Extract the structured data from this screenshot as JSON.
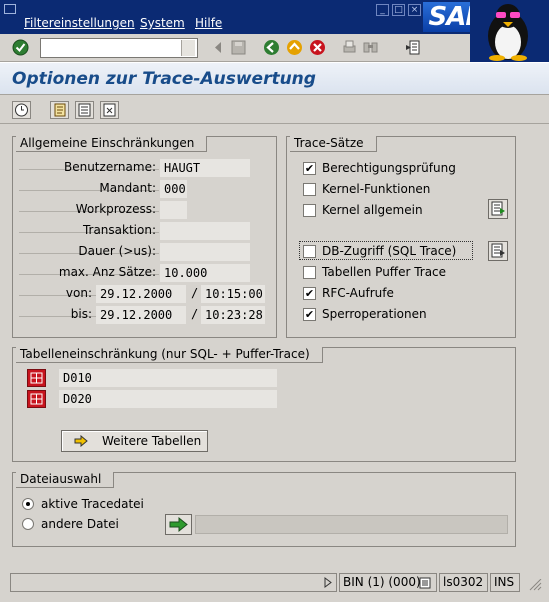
{
  "menu": {
    "items": [
      "Filtereinstellungen",
      "System",
      "Hilfe"
    ]
  },
  "branding": {
    "logo_text": "SAP"
  },
  "toolbar": {
    "command_value": ""
  },
  "title": "Optionen zur Trace-Auswertung",
  "general": {
    "title": "Allgemeine Einschränkungen",
    "fields": [
      {
        "label": "Benutzername:",
        "value": "HAUGT"
      },
      {
        "label": "Mandant:",
        "value": "000"
      },
      {
        "label": "Workprozess:",
        "value": ""
      },
      {
        "label": "Transaktion:",
        "value": ""
      },
      {
        "label": "Dauer (>us):",
        "value": ""
      },
      {
        "label": "max. Anz Sätze:",
        "value": "10.000"
      }
    ],
    "from": {
      "label": "von:",
      "date": "29.12.2000",
      "sep": "/",
      "time": "10:15:00"
    },
    "to": {
      "label": "bis:",
      "date": "29.12.2000",
      "sep": "/",
      "time": "10:23:28"
    }
  },
  "trace": {
    "title": "Trace-Sätze",
    "items": [
      {
        "label": "Berechtigungsprüfung",
        "checked": true
      },
      {
        "label": "Kernel-Funktionen",
        "checked": false
      },
      {
        "label": "Kernel allgemein",
        "checked": false
      },
      {
        "label": "DB-Zugriff (SQL Trace)",
        "checked": false
      },
      {
        "label": "Tabellen Puffer Trace",
        "checked": false
      },
      {
        "label": "RFC-Aufrufe",
        "checked": true
      },
      {
        "label": "Sperroperationen",
        "checked": true
      }
    ]
  },
  "tables": {
    "title": "Tabelleneinschränkung (nur SQL- + Puffer-Trace)",
    "rows": [
      "D010",
      "D020"
    ],
    "more_button": "Weitere Tabellen"
  },
  "file": {
    "title": "Dateiauswahl",
    "options": [
      {
        "label": "aktive Tracedatei",
        "selected": true
      },
      {
        "label": "andere Datei",
        "selected": false
      }
    ],
    "path_value": ""
  },
  "status": {
    "system": "BIN (1) (000)",
    "server": "ls0302",
    "mode": "INS"
  },
  "colors": {
    "menubar": "#0b2a73",
    "title": "#184c8a",
    "ok": "#1f8a1f",
    "cancel": "#c8141e"
  }
}
